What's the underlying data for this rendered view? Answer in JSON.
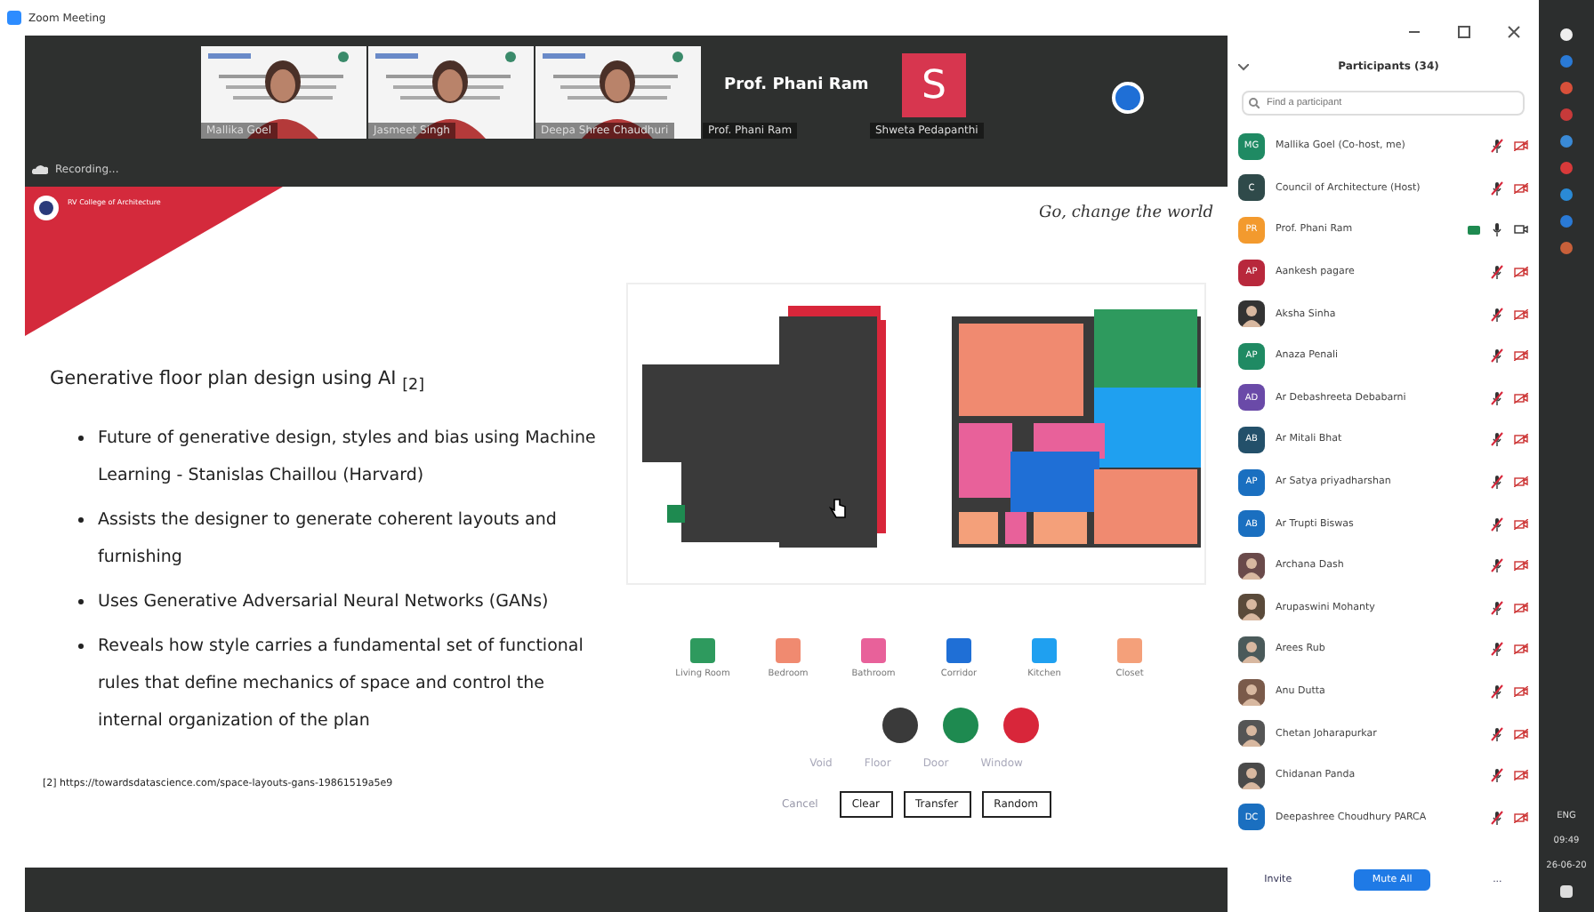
{
  "window": {
    "title": "Zoom Meeting"
  },
  "video_strip": {
    "tiles": [
      {
        "kind": "video",
        "name": "Mallika Goel"
      },
      {
        "kind": "video",
        "name": "Jasmeet Singh"
      },
      {
        "kind": "video",
        "name": "Deepa Shree Chaudhuri"
      },
      {
        "kind": "name",
        "title": "Prof. Phani Ram",
        "name": "Prof. Phani Ram"
      },
      {
        "kind": "letter",
        "letter": "S",
        "color": "#d7364f",
        "name": "Shweta Pedapanthi"
      }
    ],
    "recording": "Recording..."
  },
  "slide": {
    "logo_text": "RV College of Architecture",
    "tagline": "Go, change the world",
    "title": "Generative floor plan design using AI $_{[2]}$",
    "bullets": [
      "Future of generative design, styles and bias using Machine Learning - Stanislas Chaillou (Harvard)",
      "Assists the designer to generate coherent layouts and furnishing",
      "Uses Generative Adversarial Neural Networks (GANs)",
      "Reveals how style carries a fundamental set of functional rules that define mechanics of space and control the internal organization of the plan"
    ],
    "footnote": "[2] https://towardsdatascience.com/space-layouts-gans-19861519a5e9",
    "rooms": [
      {
        "label": "Living Room",
        "color": "#2e9a5e"
      },
      {
        "label": "Bedroom",
        "color": "#f08a70"
      },
      {
        "label": "Bathroom",
        "color": "#e8619a"
      },
      {
        "label": "Corridor",
        "color": "#1f6fd6"
      },
      {
        "label": "Kitchen",
        "color": "#1fa0f0"
      },
      {
        "label": "Closet",
        "color": "#f4a07a"
      }
    ],
    "brushes": [
      {
        "color": "#3a3a3a"
      },
      {
        "color": "#1e8a50"
      },
      {
        "color": "#d8263a"
      }
    ],
    "brush_labels": [
      "Void",
      "Floor",
      "Door",
      "Window"
    ],
    "actions": [
      {
        "label": "Cancel",
        "kind": "link"
      },
      {
        "label": "Clear",
        "kind": "button"
      },
      {
        "label": "Transfer",
        "kind": "button"
      },
      {
        "label": "Random",
        "kind": "button"
      }
    ]
  },
  "participants": {
    "title": "Participants (34)",
    "search": {
      "placeholder": "Find a participant"
    },
    "items": [
      {
        "name": "Mallika Goel (Co-host, me)",
        "kind": "initials",
        "initials": "MG",
        "color": "#1f8a63",
        "muted": true,
        "video": false
      },
      {
        "name": "Council of Architecture (Host)",
        "kind": "initials",
        "initials": "C",
        "color": "#2f4a4a",
        "muted": true,
        "video": false
      },
      {
        "name": "Prof. Phani Ram",
        "kind": "initials",
        "initials": "PR",
        "color": "#f39a2e",
        "muted": false,
        "video": true
      },
      {
        "name": "Aankesh pagare",
        "kind": "initials",
        "initials": "AP",
        "color": "#b8283c",
        "muted": true,
        "video": false
      },
      {
        "name": "Aksha Sinha",
        "color": "#333333",
        "muted": true,
        "video": false
      },
      {
        "name": "Anaza Penali",
        "kind": "initials",
        "initials": "AP",
        "color": "#1f8a63",
        "muted": true,
        "video": false
      },
      {
        "name": "Ar Debashreeta Debabarni",
        "kind": "initials",
        "initials": "AD",
        "color": "#6a4aa8",
        "muted": true,
        "video": false
      },
      {
        "name": "Ar Mitali Bhat",
        "kind": "initials",
        "initials": "AB",
        "color": "#23506a",
        "muted": true,
        "video": false
      },
      {
        "name": "Ar Satya priyadharshan",
        "kind": "initials",
        "initials": "AP",
        "color": "#1a6fc0",
        "muted": true,
        "video": false
      },
      {
        "name": "Ar Trupti Biswas",
        "kind": "initials",
        "initials": "AB",
        "color": "#1a6fc0",
        "muted": true,
        "video": false
      },
      {
        "name": "Archana Dash",
        "color": "#6a4a4a",
        "muted": true,
        "video": false
      },
      {
        "name": "Arupaswini Mohanty",
        "color": "#5a4a3a",
        "muted": true,
        "video": false
      },
      {
        "name": "Arees Rub",
        "color": "#4a5a5a",
        "muted": true,
        "video": false
      },
      {
        "name": "Anu Dutta",
        "color": "#7a5a4a",
        "muted": true,
        "video": false
      },
      {
        "name": "Chetan Joharapurkar",
        "color": "#555555",
        "muted": true,
        "video": false
      },
      {
        "name": "Chidanan Panda",
        "color": "#4a4a4a",
        "muted": true,
        "video": false
      },
      {
        "name": "Deepashree Choudhury PARCA",
        "kind": "initials",
        "initials": "DC",
        "color": "#1a6fc0",
        "muted": true,
        "video": false
      }
    ],
    "buttons": [
      "Invite",
      "Mute All",
      "..."
    ]
  },
  "taskbar": {
    "language": "ENG",
    "time": "09:49",
    "date": "26-06-20"
  }
}
